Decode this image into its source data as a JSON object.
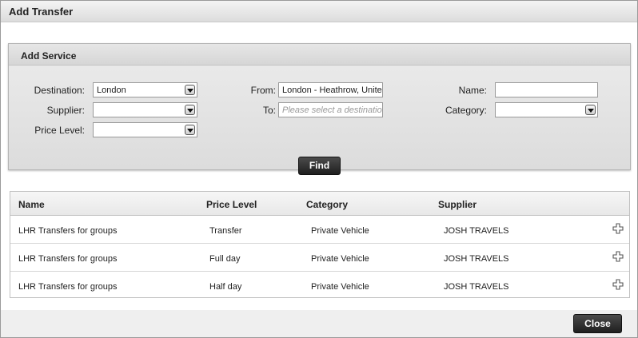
{
  "dialog": {
    "title": "Add Transfer"
  },
  "panel": {
    "title": "Add Service",
    "destination": {
      "label": "Destination:",
      "value": "London"
    },
    "supplier": {
      "label": "Supplier:",
      "value": ""
    },
    "price_level": {
      "label": "Price Level:",
      "value": ""
    },
    "from": {
      "label": "From:",
      "value": "London - Heathrow, United Kingdom"
    },
    "to": {
      "label": "To:",
      "placeholder": "Please select a destination"
    },
    "name": {
      "label": "Name:",
      "value": ""
    },
    "category": {
      "label": "Category:",
      "value": ""
    },
    "find_label": "Find"
  },
  "results": {
    "columns": [
      "Name",
      "Price Level",
      "Category",
      "Supplier"
    ],
    "rows": [
      {
        "name": "LHR Transfers for groups",
        "price_level": "Transfer",
        "category": "Private Vehicle",
        "supplier": "JOSH TRAVELS",
        "action_icon": "plus-icon"
      },
      {
        "name": "LHR Transfers for groups",
        "price_level": "Full day",
        "category": "Private Vehicle",
        "supplier": "JOSH TRAVELS",
        "action_icon": "plus-icon"
      },
      {
        "name": "LHR Transfers for groups",
        "price_level": "Half day",
        "category": "Private Vehicle",
        "supplier": "JOSH TRAVELS",
        "action_icon": "plus-icon"
      }
    ]
  },
  "footer": {
    "close_label": "Close"
  }
}
